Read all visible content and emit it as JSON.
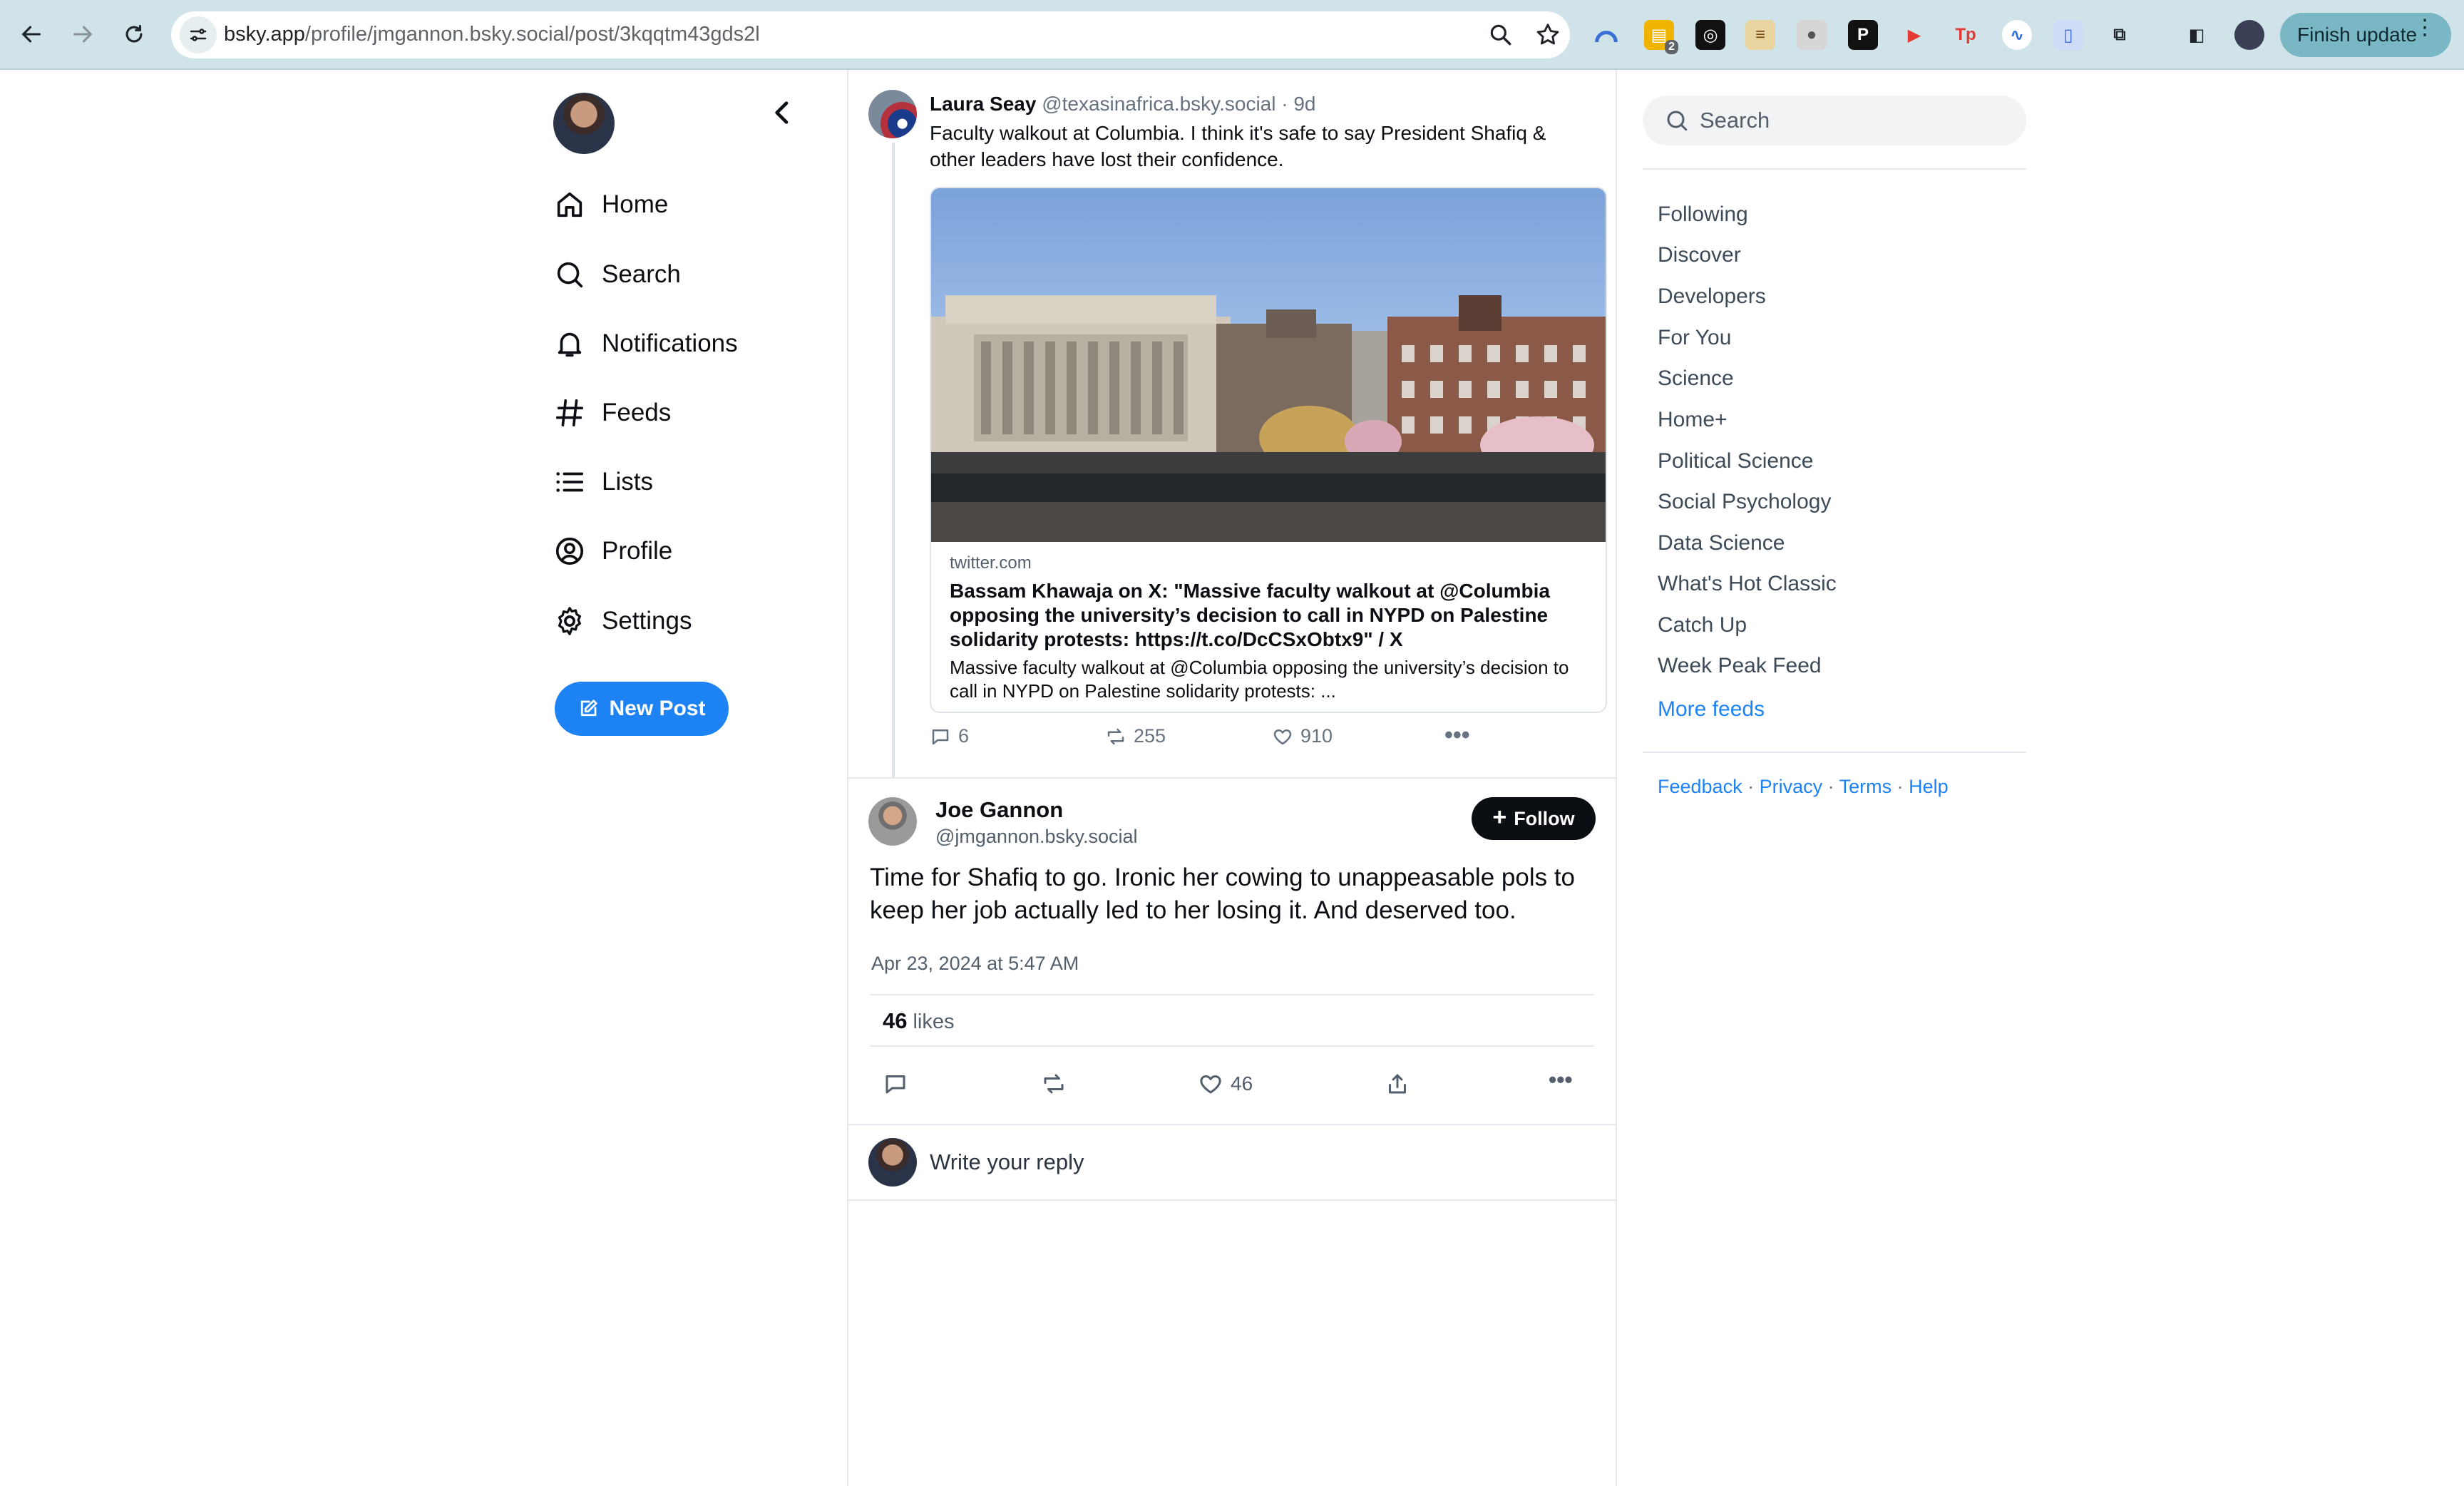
{
  "browser": {
    "url_host": "bsky.app",
    "url_path": "/profile/jmgannon.bsky.social/post/3kqqtm43gds2l",
    "extension_badge": "2",
    "update_label": "Finish update"
  },
  "sidebar": {
    "items": [
      {
        "label": "Home",
        "icon": "home-icon"
      },
      {
        "label": "Search",
        "icon": "search-icon"
      },
      {
        "label": "Notifications",
        "icon": "bell-icon"
      },
      {
        "label": "Feeds",
        "icon": "hash-icon"
      },
      {
        "label": "Lists",
        "icon": "list-icon"
      },
      {
        "label": "Profile",
        "icon": "user-circle-icon"
      },
      {
        "label": "Settings",
        "icon": "gear-icon"
      }
    ],
    "new_post_label": "New Post"
  },
  "parent_post": {
    "author_name": "Laura Seay",
    "author_handle": "@texasinafrica.bsky.social",
    "age": "· 9d",
    "text": "Faculty walkout at Columbia. I think it's safe to say President Shafiq & other leaders have lost their confidence.",
    "embed": {
      "domain": "twitter.com",
      "title": "Bassam Khawaja on X: \"Massive faculty walkout at @Columbia opposing the university’s decision to call in NYPD on Palestine solidarity protests: https://t.co/DcCSxObtx9\" / X",
      "description": "Massive faculty walkout at @Columbia opposing the university’s decision to call in NYPD on Palestine solidarity protests: ..."
    },
    "replies": "6",
    "reposts": "255",
    "likes": "910"
  },
  "main_post": {
    "author_name": "Joe Gannon",
    "author_handle": "@jmgannon.bsky.social",
    "follow_label": "Follow",
    "text": "Time for Shafiq to go. Ironic her cowing to unappeasable pols to keep her job actually led to her losing it. And deserved too.",
    "timestamp": "Apr 23, 2024 at 5:47 AM",
    "likes_count": "46",
    "likes_word": "likes",
    "like_action_count": "46",
    "reply_placeholder": "Write your reply"
  },
  "right_panel": {
    "search_placeholder": "Search",
    "feeds": [
      "Following",
      "Discover",
      "Developers",
      "For You",
      "Science",
      "Home+",
      "Political Science",
      "Social Psychology",
      "Data Science",
      "What's Hot Classic",
      "Catch Up",
      "Week Peak Feed"
    ],
    "more_feeds": "More feeds",
    "footer": [
      "Feedback",
      "Privacy",
      "Terms",
      "Help"
    ],
    "footer_sep": " · "
  },
  "colors": {
    "accent": "#1d83f5",
    "chrome": "#cfe3e9",
    "text": "#0b0f14",
    "muted": "#66727f"
  }
}
